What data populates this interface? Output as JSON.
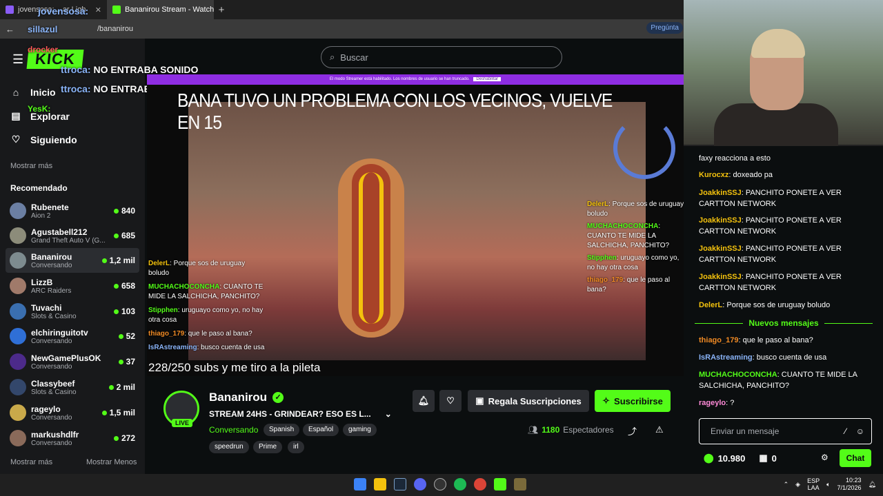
{
  "browser": {
    "tabs": [
      {
        "label": "jovensosa: ...ar Ligh",
        "active": false
      },
      {
        "label": "Bananirou Stream - Watch L",
        "active": true
      }
    ],
    "new_tab": "+",
    "address": "/bananirou",
    "ask_label": "Pregúnta"
  },
  "sidebar": {
    "nav": [
      {
        "label": "Inicio",
        "icon": "home-icon"
      },
      {
        "label": "Explorar",
        "icon": "compass-icon"
      },
      {
        "label": "Siguiendo",
        "icon": "heart-icon"
      }
    ],
    "show_more_top": "Mostrar más",
    "recommended_title": "Recomendado",
    "recommended": [
      {
        "name": "Rubenete",
        "category": "Aion 2",
        "viewers": "840"
      },
      {
        "name": "Agustabell212",
        "category": "Grand Theft Auto V (G...",
        "viewers": "685"
      },
      {
        "name": "Bananirou",
        "category": "Conversando",
        "viewers": "1,2 mil"
      },
      {
        "name": "LizzB",
        "category": "ARC Raiders",
        "viewers": "658"
      },
      {
        "name": "Tuvachi",
        "category": "Slots & Casino",
        "viewers": "103"
      },
      {
        "name": "elchiringuitotv",
        "category": "Conversando",
        "viewers": "52"
      },
      {
        "name": "NewGamePlusOK",
        "category": "Conversando",
        "viewers": "37"
      },
      {
        "name": "Classybeef",
        "category": "Slots & Casino",
        "viewers": "2 mil"
      },
      {
        "name": "rageylo",
        "category": "Conversando",
        "viewers": "1,5 mil"
      },
      {
        "name": "markushdlfr",
        "category": "Conversando",
        "viewers": "272"
      }
    ],
    "show_more": "Mostrar más",
    "show_less": "Mostrar Menos"
  },
  "search": {
    "placeholder": "Buscar"
  },
  "overlay_top": [
    {
      "user": "jovensosa:",
      "text": ""
    },
    {
      "user": "sillazul",
      "text": ""
    },
    {
      "user": "drocker",
      "text": ""
    },
    {
      "user": "ttroca:",
      "text": "NO ENTRABA SONIDO"
    },
    {
      "user": "ttroca:",
      "text": "NO ENTRABA SONIDO"
    },
    {
      "user": "YesK:",
      "text": ""
    }
  ],
  "player": {
    "streamer_banner": "El modo Streamer está habilitado. Los nombres de usuario se han truncado.",
    "streamer_banner_button": "Deshabilitar",
    "headline": "BANA TUVO UN PROBLEMA CON LOS VECINOS, VUELVE EN 15",
    "subs_goal": "228/250 subs y me tiro a la pileta",
    "left_chat": [
      {
        "user": "DelerL",
        "text": ": Porque sos de uruguay boludo"
      },
      {
        "user": "MUCHACHOCONCHA",
        "text": ": CUANTO TE MIDE LA SALCHICHA, PANCHITO?"
      },
      {
        "user": "Stipphen",
        "text": ": uruguayo como yo, no hay otra cosa"
      },
      {
        "user": "thiago_179",
        "text": ": que le paso al bana?"
      },
      {
        "user": "IsRAstreaming",
        "text": ": busco cuenta de usa"
      }
    ],
    "right_chat": [
      {
        "user": "DelerL",
        "text": ": Porque sos de uruguay boludo"
      },
      {
        "user": "MUCHACHOCONCHA",
        "text": ": CUANTO TE MIDE LA SALCHICHA, PANCHITO?"
      },
      {
        "user": "Stipphen",
        "text": ": uruguayo como yo, no hay otra cosa"
      },
      {
        "user": "thiago_179",
        "text": ": que le paso al bana?"
      }
    ]
  },
  "channel": {
    "name": "Bananirou",
    "live": "LIVE",
    "title": "STREAM 24HS - GRINDEAR? ESO ES L...",
    "category": "Conversando",
    "tags": [
      "Spanish",
      "Español",
      "gaming",
      "speedrun",
      "Prime",
      "irl"
    ],
    "gift_label": "Regala Suscripciones",
    "subscribe_label": "Suscribirse",
    "viewers_count": "1180",
    "viewers_label": "Espectadores"
  },
  "chat": {
    "messages": [
      {
        "user": "",
        "text": "faxy reacciona a esto",
        "color": "#ffffff"
      },
      {
        "user": "Kurocxz",
        "text": ": doxeado pa",
        "color": "#f4c20d"
      },
      {
        "user": "JoakkinSSJ",
        "text": ": PANCHITO PONETE A VER CARTTON NETWORK",
        "color": "#f4c20d"
      },
      {
        "user": "JoakkinSSJ",
        "text": ": PANCHITO PONETE A VER CARTTON NETWORK",
        "color": "#f4c20d"
      },
      {
        "user": "JoakkinSSJ",
        "text": ": PANCHITO PONETE A VER CARTTON NETWORK",
        "color": "#f4c20d"
      },
      {
        "user": "JoakkinSSJ",
        "text": ": PANCHITO PONETE A VER CARTTON NETWORK",
        "color": "#f4c20d"
      },
      {
        "user": "DelerL",
        "text": ": Porque sos de uruguay boludo",
        "color": "#f4c20d"
      }
    ],
    "new_messages_label": "Nuevos mensajes",
    "new_messages": [
      {
        "user": "thiago_179",
        "text": ": que le paso al bana?",
        "color": "#f08a24"
      },
      {
        "user": "IsRAstreaming",
        "text": ": busco cuenta de usa",
        "color": "#8ab4f8"
      },
      {
        "user": "MUCHACHOCONCHA",
        "text": ": CUANTO TE MIDE LA SALCHICHA, PANCHITO?",
        "color": "#53fc18"
      },
      {
        "user": "rageylo",
        "text": ": ?",
        "color": "#ff8ad8"
      }
    ],
    "input_placeholder": "Enviar un mensaje",
    "points": "10.980",
    "other_count": "0",
    "chat_button": "Chat"
  },
  "taskbar": {
    "lang": "ESP",
    "lang2": "LAA",
    "time": "10:23",
    "date": "7/1/2026"
  },
  "colors": {
    "accent": "#53fc18",
    "bg": "#0b0e0f",
    "sidebar": "#18191b"
  }
}
